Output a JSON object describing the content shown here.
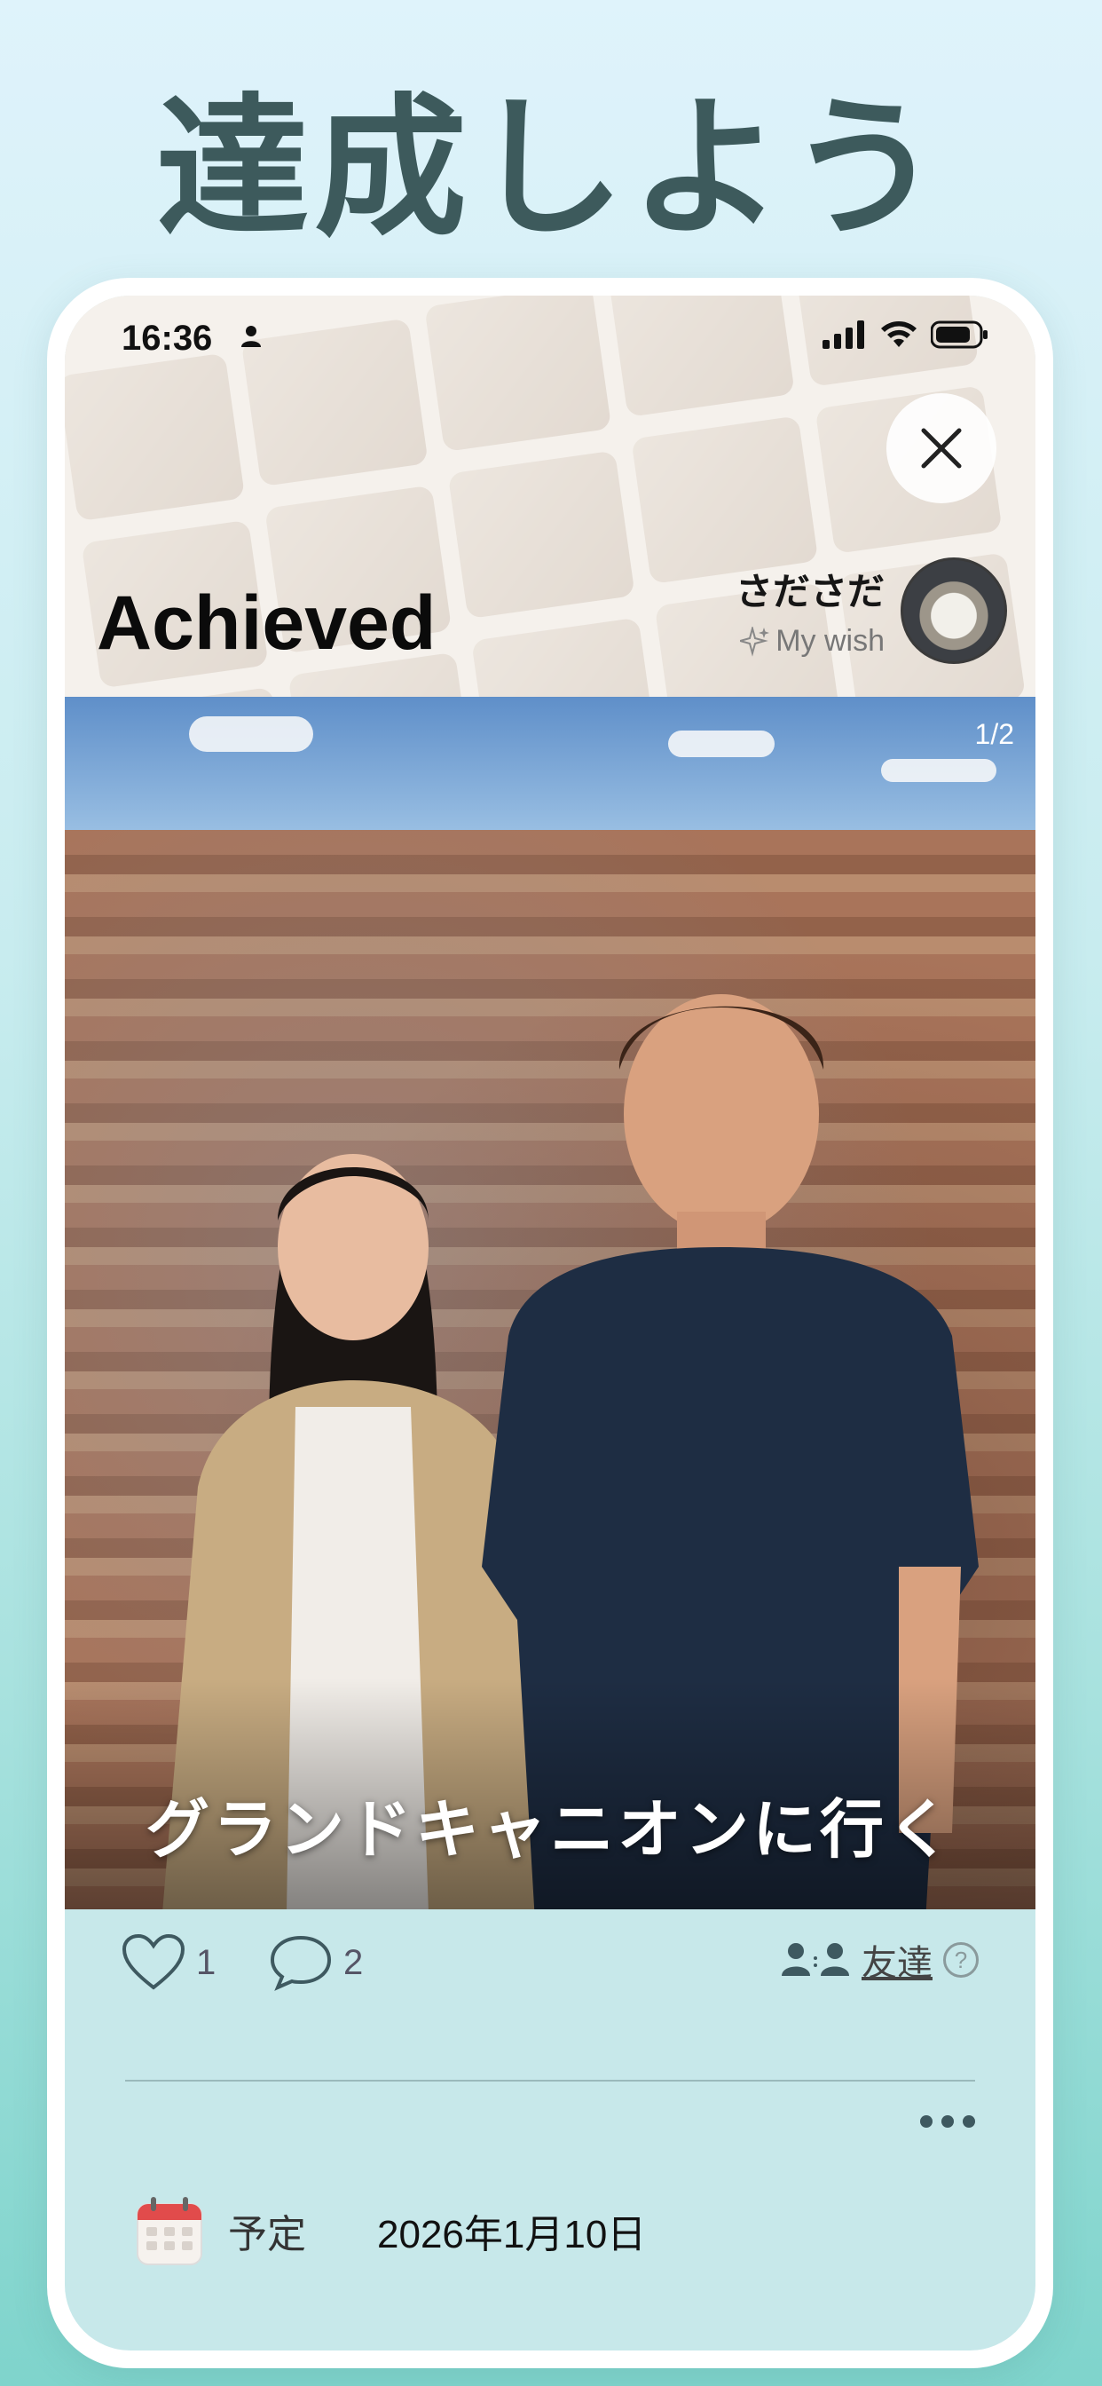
{
  "headline": "達成しよう",
  "status_bar": {
    "time": "16:36"
  },
  "header": {
    "title": "Achieved",
    "user_name": "さださだ",
    "wish_label": "My wish"
  },
  "photo": {
    "counter": "1/2",
    "caption": "グランドキャニオンに行く"
  },
  "actions": {
    "likes": "1",
    "comments": "2",
    "visibility": "友達",
    "help": "?"
  },
  "schedule": {
    "label": "予定",
    "date": "2026年1月10日"
  },
  "colors": {
    "accent": "#3d5a5c",
    "panel": "#c7e8ea"
  }
}
